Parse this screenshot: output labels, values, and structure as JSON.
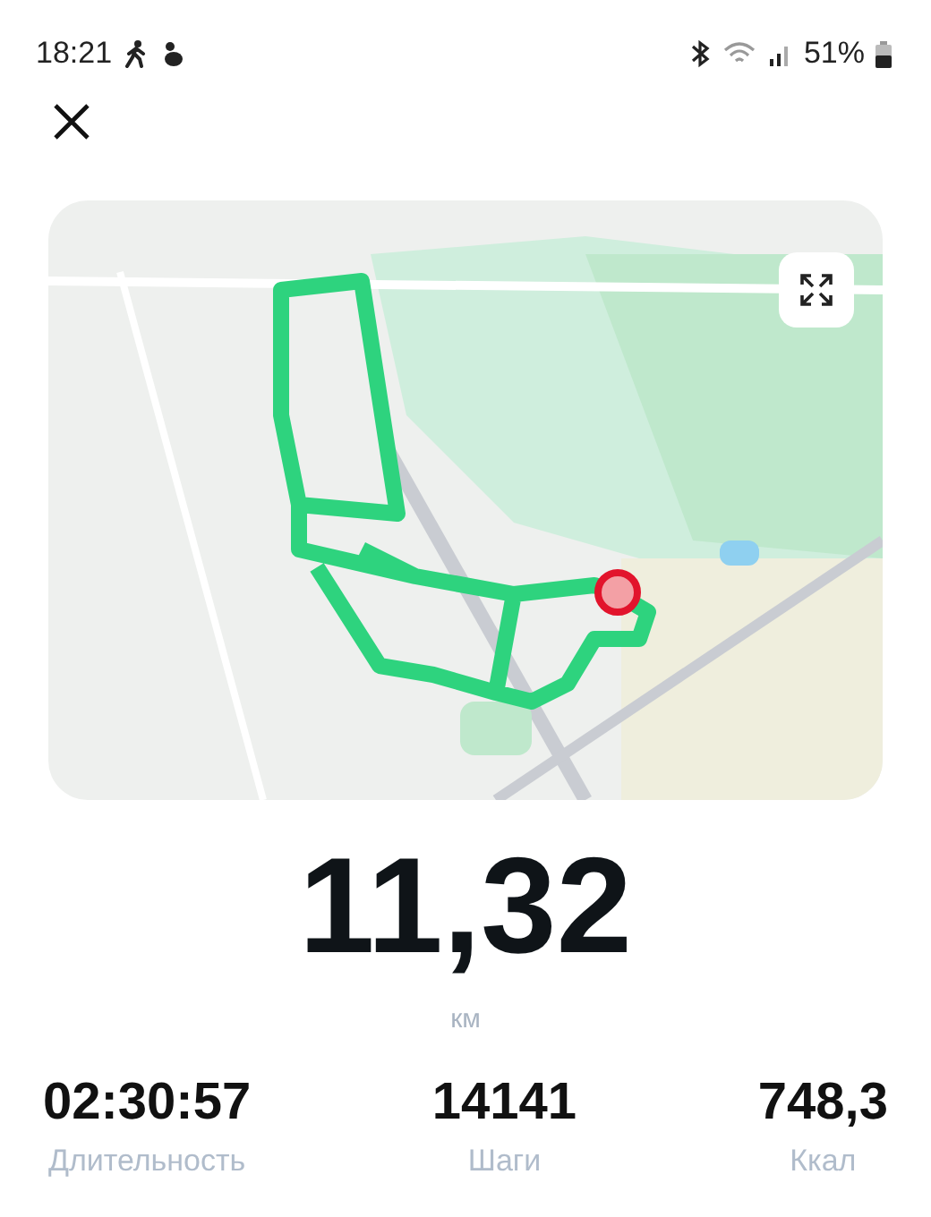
{
  "status_bar": {
    "time": "18:21",
    "battery": "51%"
  },
  "distance": {
    "value": "11,32",
    "unit": "км"
  },
  "stats": [
    {
      "value": "02:30:57",
      "label": "Длительность"
    },
    {
      "value": "14141",
      "label": "Шаги"
    },
    {
      "value": "748,3",
      "label": "Ккал"
    }
  ]
}
